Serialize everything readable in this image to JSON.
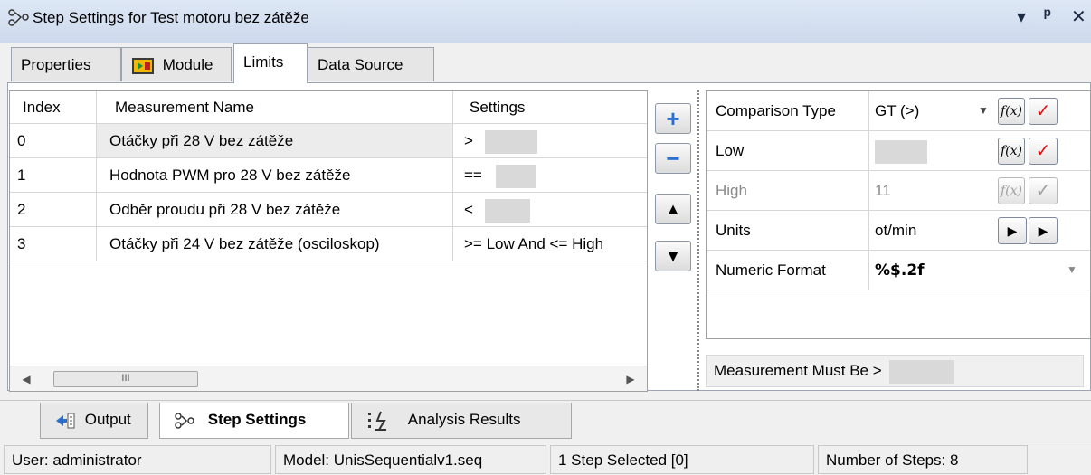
{
  "window": {
    "title": "Step Settings for Test motoru bez zátěže",
    "title_icon": "step-settings-icon",
    "controls": {
      "dropdown": "▾",
      "pin": "ᵖ",
      "close": "✕"
    }
  },
  "tabs": [
    {
      "label": "Properties",
      "icon": ""
    },
    {
      "label": "Module",
      "icon": "module-icon"
    },
    {
      "label": "Limits",
      "icon": ""
    },
    {
      "label": "Data Source",
      "icon": ""
    }
  ],
  "active_tab": "Limits",
  "grid": {
    "columns": [
      "Index",
      "Measurement Name",
      "Settings"
    ],
    "rows": [
      {
        "index": "0",
        "name": "Otáčky při 28 V bez zátěže",
        "settings": ">"
      },
      {
        "index": "1",
        "name": "Hodnota PWM pro 28 V bez zátěže",
        "settings": "=="
      },
      {
        "index": "2",
        "name": "Odběr proudu při 28 V bez zátěže",
        "settings": "<"
      },
      {
        "index": "3",
        "name": "Otáčky při 24 V bez zátěže (osciloskop)",
        "settings": ">= Low And <= High"
      }
    ],
    "scroll_thumb": "III"
  },
  "side_buttons": {
    "add": "+",
    "remove": "−",
    "up": "▲",
    "down": "▼"
  },
  "properties": {
    "comparison_type": {
      "label": "Comparison Type",
      "value": "GT (>)"
    },
    "low": {
      "label": "Low",
      "value": ""
    },
    "high": {
      "label": "High",
      "value": "11"
    },
    "units": {
      "label": "Units",
      "value": "ot/min"
    },
    "numeric_format": {
      "label": "Numeric Format",
      "value": "%$.2f"
    }
  },
  "fx_label": "f(x)",
  "check_glyph": "✓",
  "measurement_must_be": "Measurement Must Be >",
  "bottom_tabs": [
    {
      "label": "Output",
      "icon": "output-icon"
    },
    {
      "label": "Step Settings",
      "icon": "step-settings-icon"
    },
    {
      "label": "Analysis Results",
      "icon": "analysis-results-icon"
    }
  ],
  "statusbar": {
    "user": "User: administrator",
    "model": "Model: UnisSequentialv1.seq",
    "selected": "1 Step Selected [0]",
    "steps": "Number of Steps: 8"
  },
  "colors": {
    "check_red": "#e01010",
    "title_bg": "#dde7f5",
    "add_blue": "#2a6fd0"
  }
}
